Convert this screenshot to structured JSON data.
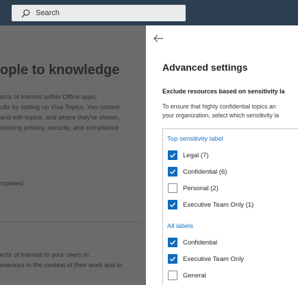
{
  "header": {
    "search_placeholder": "Search"
  },
  "background": {
    "heading": "ople to knowledge",
    "para1": [
      "ects of interest within Office apps,",
      "ults by setting up Viva Topics. You control",
      "and edit topics, and where they're shown.",
      "existing privacy, security, and compliance"
    ],
    "status": "mpleted",
    "para2": [
      "ects of interest to your users in",
      "eriences in the context of their work and in"
    ]
  },
  "panel": {
    "title": "Advanced settings",
    "section_heading": "Exclude resources based on sensitivity la",
    "section_desc": [
      "To ensure that highly confidential topics an",
      "your organization, select which sensitivity la"
    ],
    "top_group_label": "Top sensitivity label",
    "top_labels": [
      {
        "label": "Legal (7)",
        "checked": true
      },
      {
        "label": "Confidential (6)",
        "checked": true
      },
      {
        "label": "Personal (2)",
        "checked": false
      },
      {
        "label": "Executive Team Only (1)",
        "checked": true
      }
    ],
    "all_group_label": "All labels",
    "all_labels": [
      {
        "label": "Confidential",
        "checked": true
      },
      {
        "label": "Executive Team Only",
        "checked": true
      },
      {
        "label": "General",
        "checked": false
      }
    ]
  },
  "colors": {
    "accent": "#0f6cbd",
    "topbar": "#2c3e50",
    "link": "#1a73c8"
  }
}
